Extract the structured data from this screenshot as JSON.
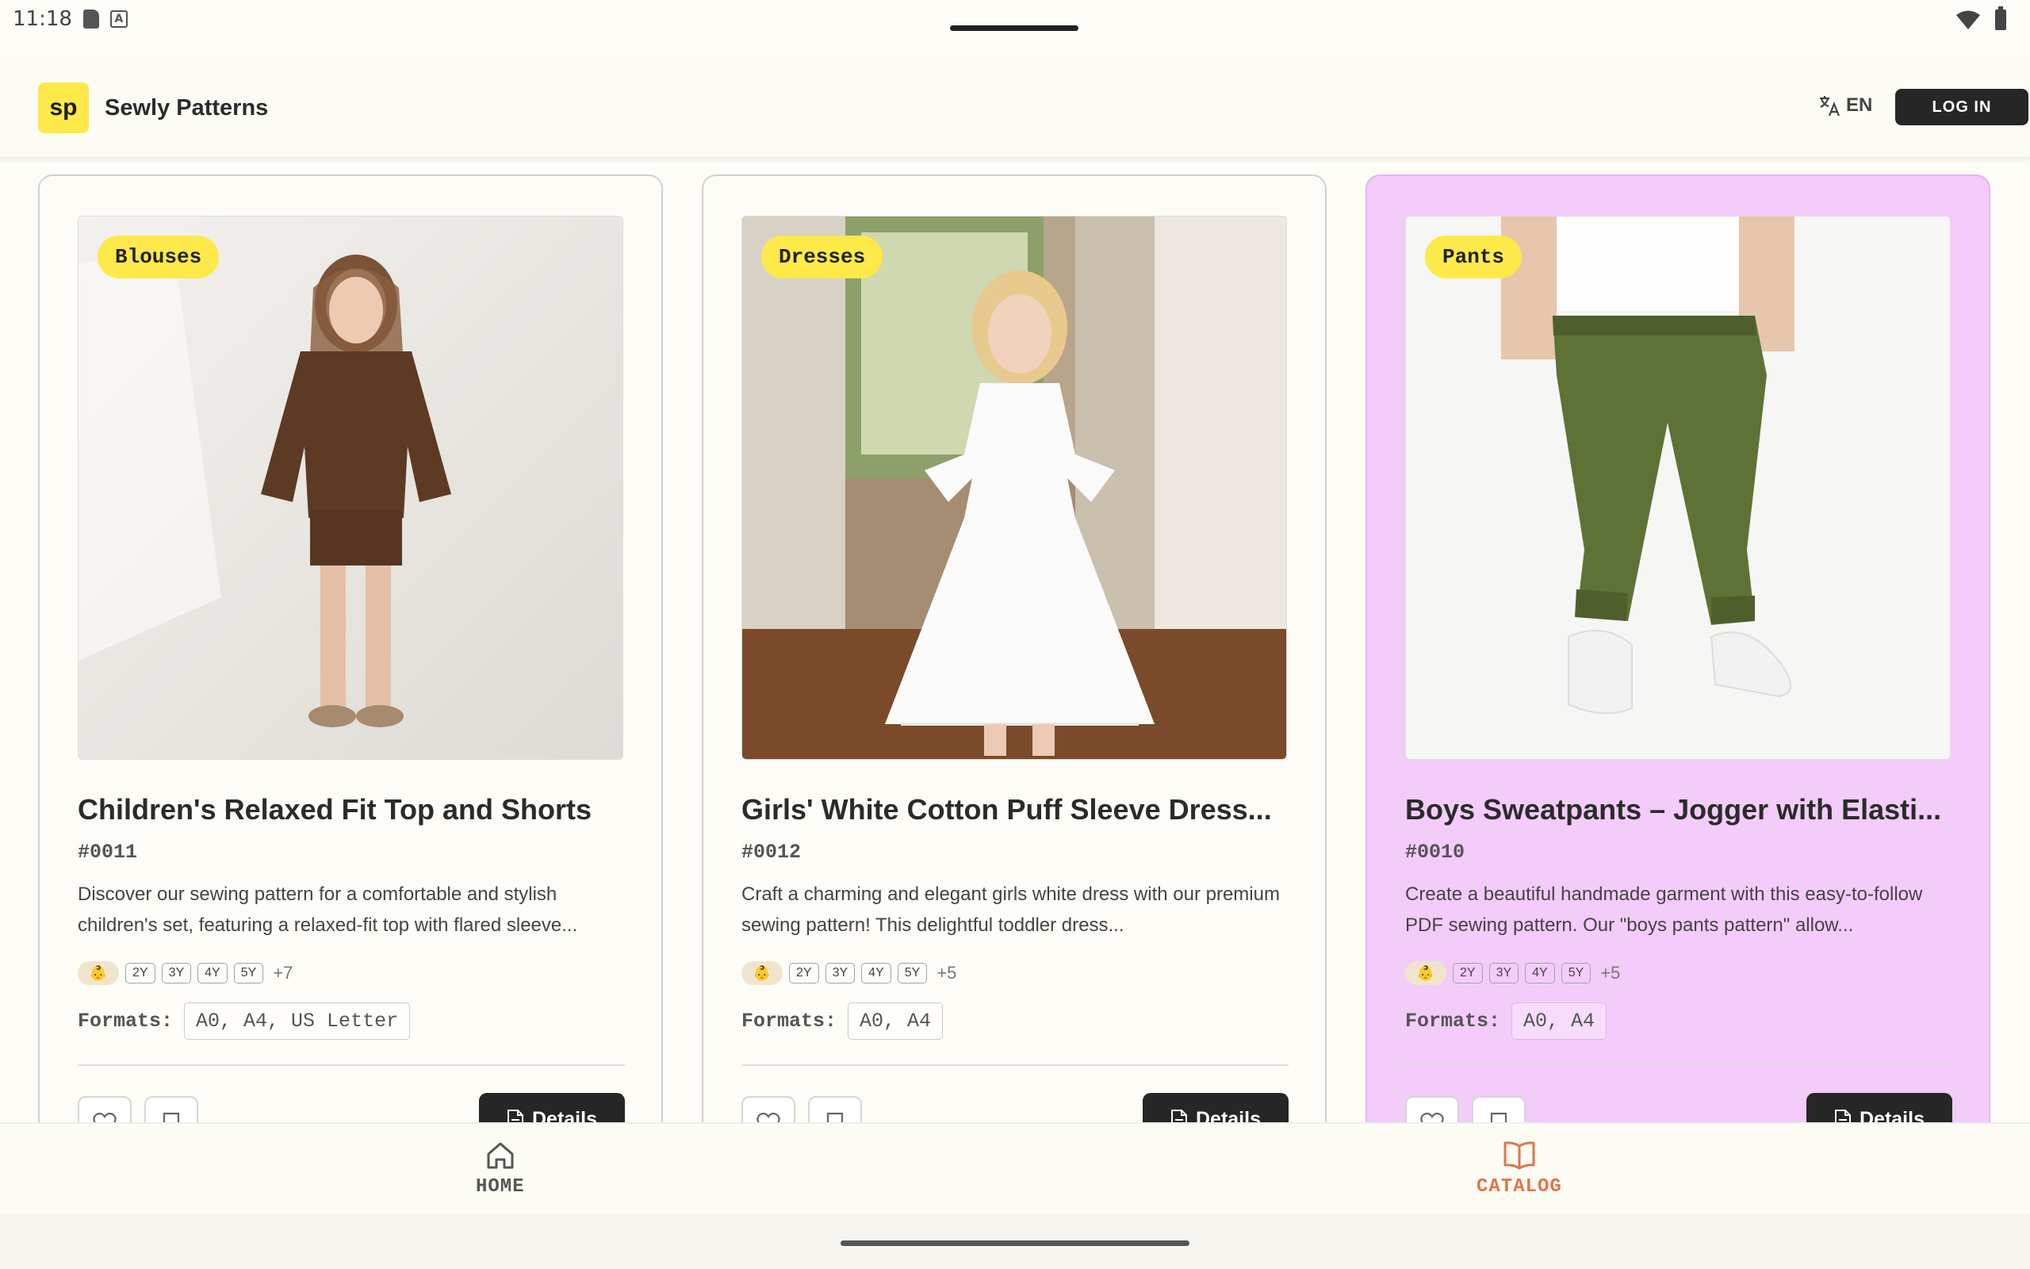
{
  "status": {
    "time": "11:18"
  },
  "header": {
    "logo": "sp",
    "brand": "Sewly Patterns",
    "lang": "EN",
    "login": "LOG IN"
  },
  "cards": [
    {
      "category": "Blouses",
      "title": "Children's Relaxed Fit Top and Shorts",
      "code": "#0011",
      "description": "Discover our sewing pattern for a comfortable and stylish children's set, featuring a relaxed-fit top with flared sleeve...",
      "sizes": [
        "2Y",
        "3Y",
        "4Y",
        "5Y"
      ],
      "more": "+7",
      "formats_label": "Formats:",
      "formats": "A0, A4, US Letter",
      "details": "Details"
    },
    {
      "category": "Dresses",
      "title": "Girls' White Cotton Puff Sleeve Dress...",
      "code": "#0012",
      "description": "Craft a charming and elegant girls white dress with our premium sewing pattern! This delightful toddler dress...",
      "sizes": [
        "2Y",
        "3Y",
        "4Y",
        "5Y"
      ],
      "more": "+5",
      "formats_label": "Formats:",
      "formats": "A0, A4",
      "details": "Details"
    },
    {
      "category": "Pants",
      "title": "Boys Sweatpants – Jogger with Elasti...",
      "code": "#0010",
      "description": "Create a beautiful handmade garment with this easy-to-follow PDF sewing pattern. Our \"boys pants pattern\" allow...",
      "sizes": [
        "2Y",
        "3Y",
        "4Y",
        "5Y"
      ],
      "more": "+5",
      "formats_label": "Formats:",
      "formats": "A0, A4",
      "details": "Details"
    }
  ],
  "nav": {
    "home": "HOME",
    "catalog": "CATALOG"
  },
  "colors": {
    "accent": "#fde94a",
    "highlight": "#f3ccfa",
    "catalog_active": "#e0764a"
  },
  "icons": [
    "sd-card-icon",
    "keyboard-a-icon",
    "wifi-icon",
    "battery-icon",
    "translate-icon",
    "heart-icon",
    "bookmark-icon",
    "document-icon",
    "home-icon",
    "book-icon",
    "baby-icon"
  ]
}
